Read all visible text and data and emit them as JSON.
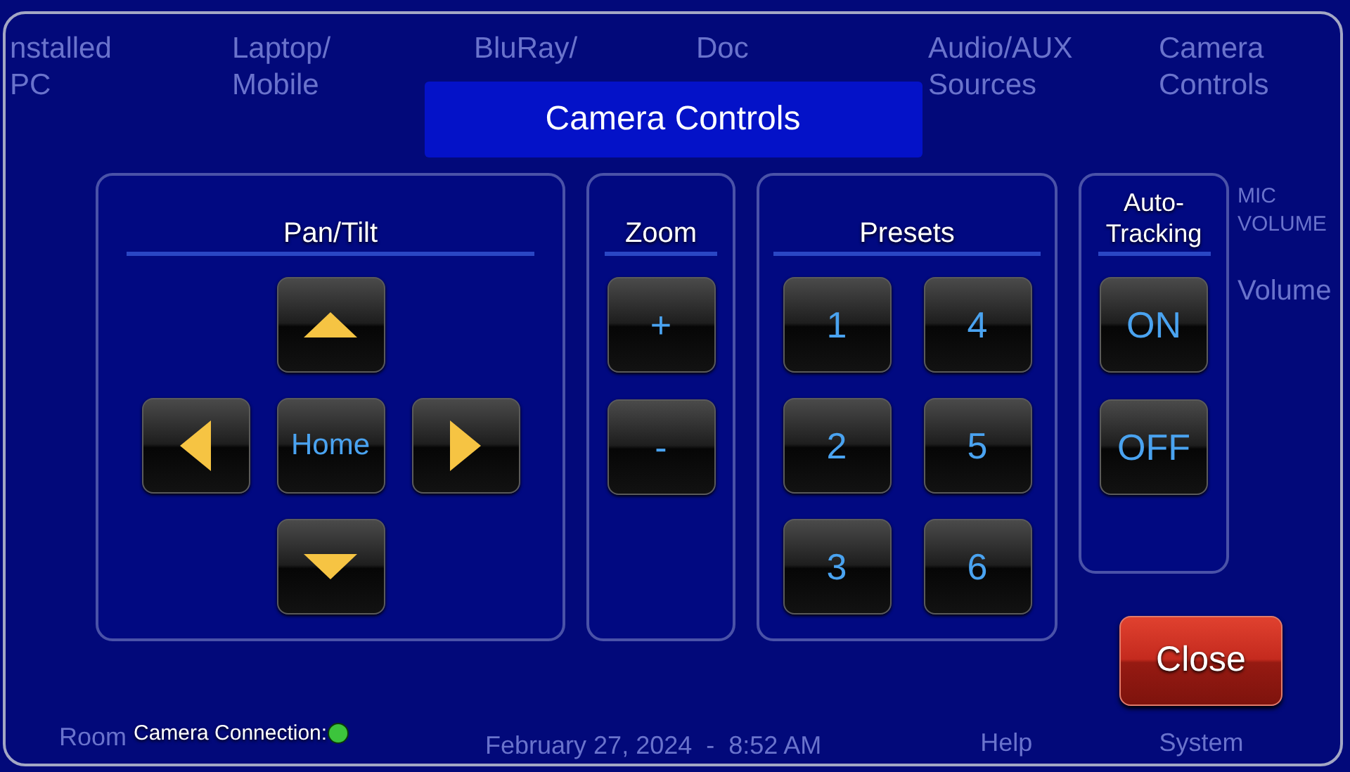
{
  "background": {
    "source_tabs": [
      {
        "lines": [
          "nstalled",
          "PC"
        ]
      },
      {
        "lines": [
          "Laptop/",
          "Mobile"
        ]
      },
      {
        "lines": [
          "BluRay/"
        ]
      },
      {
        "lines": [
          "Doc"
        ]
      },
      {
        "lines": [
          "Audio/AUX",
          "Sources"
        ]
      },
      {
        "lines": [
          "Camera",
          "Controls"
        ]
      }
    ],
    "side_labels": [
      "MIC VOLUME",
      "Volume"
    ],
    "footer": {
      "room": "Room",
      "date_time": "February 27, 2024  -  8:52 AM",
      "help": "Help",
      "system": "System"
    }
  },
  "dialog": {
    "title": "Camera Controls",
    "panels": [
      {
        "kind": "dpad",
        "heading": "Pan/Tilt",
        "center_label": "Home"
      },
      {
        "kind": "column",
        "heading": "Zoom",
        "buttons": [
          "+",
          "-"
        ]
      },
      {
        "kind": "grid",
        "heading": "Presets",
        "buttons": [
          "1",
          "4",
          "2",
          "5",
          "3",
          "6"
        ]
      },
      {
        "kind": "column",
        "heading": "Auto-Tracking",
        "buttons": [
          "ON",
          "OFF"
        ]
      }
    ],
    "close_button": "Close",
    "connection": {
      "label": "Camera Connection:",
      "connected": true
    }
  }
}
